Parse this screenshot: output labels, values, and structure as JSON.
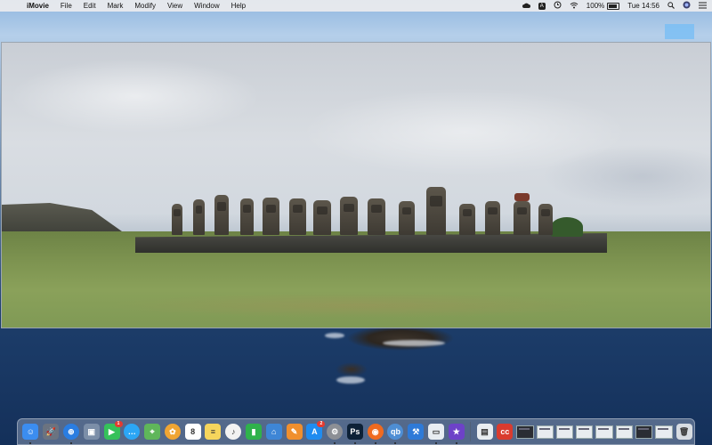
{
  "menubar": {
    "apple_glyph": "",
    "app_name": "iMovie",
    "menus": [
      "File",
      "Edit",
      "Mark",
      "Modify",
      "View",
      "Window",
      "Help"
    ],
    "status": {
      "battery_percent": "100%",
      "clock": "Tue 14:56",
      "input_letter": "A"
    }
  },
  "viewer": {
    "content": "photo-of-moai-statues-panorama"
  },
  "dock": {
    "apps": [
      {
        "name": "finder",
        "color": "#3b8df0",
        "glyph": "☺",
        "running": true
      },
      {
        "name": "launchpad",
        "color": "#6b7380",
        "glyph": "🚀",
        "running": false
      },
      {
        "name": "safari",
        "color": "#2a7de1",
        "glyph": "⊕",
        "running": true
      },
      {
        "name": "preview",
        "color": "#7b8ea8",
        "glyph": "▣",
        "running": false
      },
      {
        "name": "facetime",
        "color": "#35c15a",
        "glyph": "▶",
        "running": false,
        "badge": "1"
      },
      {
        "name": "messages",
        "color": "#2ba6f5",
        "glyph": "…",
        "running": false
      },
      {
        "name": "maps",
        "color": "#5fb65a",
        "glyph": "⌖",
        "running": false
      },
      {
        "name": "photos",
        "color": "#f0a533",
        "glyph": "✿",
        "running": false
      },
      {
        "name": "calendar",
        "color": "#ffffff",
        "glyph": "8",
        "running": false
      },
      {
        "name": "notes",
        "color": "#f6d55c",
        "glyph": "≡",
        "running": false
      },
      {
        "name": "music",
        "color": "#f2f2f2",
        "glyph": "♪",
        "running": false
      },
      {
        "name": "numbers",
        "color": "#2fb24b",
        "glyph": "▮",
        "running": false
      },
      {
        "name": "keynote",
        "color": "#3e86d6",
        "glyph": "⌂",
        "running": false
      },
      {
        "name": "pages",
        "color": "#f08f2e",
        "glyph": "✎",
        "running": false
      },
      {
        "name": "app-store",
        "color": "#1f8cf0",
        "glyph": "A",
        "running": false,
        "badge": "2"
      },
      {
        "name": "system-preferences",
        "color": "#8c8f95",
        "glyph": "⚙",
        "running": true
      },
      {
        "name": "photoshop",
        "color": "#0d2137",
        "glyph": "Ps",
        "running": true
      },
      {
        "name": "firefox",
        "color": "#f06a1f",
        "glyph": "◉",
        "running": true
      },
      {
        "name": "qbittorrent",
        "color": "#4e8ed4",
        "glyph": "qb",
        "running": true
      },
      {
        "name": "xcode",
        "color": "#2e7ad8",
        "glyph": "⚒",
        "running": false
      },
      {
        "name": "screenshot",
        "color": "#e8edf2",
        "glyph": "▭",
        "running": true
      },
      {
        "name": "imovie",
        "color": "#6d42c8",
        "glyph": "★",
        "running": true
      }
    ],
    "extras": [
      {
        "name": "documents-stack",
        "color": "#e9edf1",
        "glyph": "▤"
      },
      {
        "name": "creative-cloud",
        "color": "#da3b2e",
        "glyph": "cc"
      }
    ],
    "thumbnails": [
      "window-1",
      "window-2",
      "window-3",
      "window-4",
      "window-5",
      "window-6",
      "window-7",
      "window-8"
    ],
    "trash": {
      "name": "trash",
      "color": "#d7dce2",
      "glyph": "🗑"
    }
  }
}
